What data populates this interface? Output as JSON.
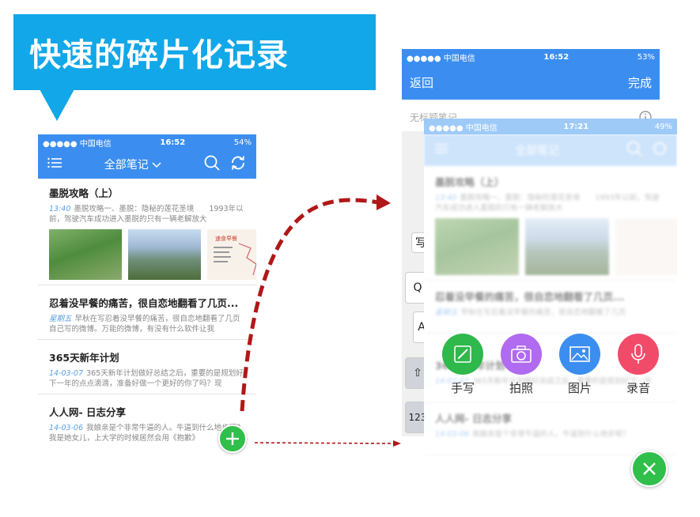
{
  "banner": {
    "title": "快速的碎片化记录"
  },
  "phone1": {
    "status": {
      "carrier": "●●●●● 中国电信",
      "time": "16:52",
      "battery": "54%"
    },
    "nav": {
      "title": "全部笔记"
    },
    "notes": [
      {
        "title": "墨脱攻略（上）",
        "date": "13:40",
        "body": "墨脱攻略一、墨脱：隐秘的莲花圣境　　1993年以前，驾驶汽车成功进入墨脱的只有一辆老解放大"
      },
      {
        "title": "忍着没早餐的痛苦，很自恋地翻看了几页...",
        "date": "星期五",
        "body": "早秋在写忍着没早餐的痛苦，很自恋地翻看了几页自己写的微博。万能的微博，有没有什么软件让我"
      },
      {
        "title": "365天新年计划",
        "date": "14-03-07",
        "body": "365天新年计划做好总结之后，重要的是规划好下一年的点点滴滴，准备好做一个更好的你了吗？现"
      },
      {
        "title": "人人网- 日志分享",
        "date": "14-03-06",
        "body": "我娘亲是个非常牛逼的人。牛逼到什么地步呢？我是她女儿，上大学的时候居然会用《抱歉》"
      }
    ],
    "thumb3_text": "速食早餐"
  },
  "phone2": {
    "status": {
      "carrier": "●●●●● 中国电信",
      "time": "16:52",
      "battery": "53%"
    },
    "nav": {
      "back": "返回",
      "done": "完成"
    },
    "untitled": "无标题笔记",
    "keys": [
      "Q",
      "A",
      "⇧",
      "123",
      "写"
    ]
  },
  "phone3": {
    "status": {
      "carrier": "●●●●● 中国电信",
      "time": "17:21",
      "battery": "49%"
    },
    "nav": {
      "title": "全部笔记"
    },
    "notes": [
      {
        "title": "墨脱攻略（上）",
        "date": "13:40",
        "body": "墨脱攻略一、墨脱：隐秘的莲花圣境　　1993年以前，驾驶汽车成功进入墨脱的只有一辆老解放大"
      },
      {
        "title": "忍着没早餐的痛苦，很自恋地翻看了几页...",
        "date": "星期五",
        "body": "早秋在写忍着没早餐的痛苦，很自恋地翻看了几页"
      },
      {
        "title": "365天新年计划",
        "date": "14-03-07",
        "body": "365天新年计划做好总结之后，重要的是规划好下一年"
      },
      {
        "title": "人人网- 日志分享",
        "date": "14-03-06",
        "body": "我娘亲是个非常牛逼的人。牛逼到什么地步呢？"
      }
    ],
    "actions": [
      {
        "label": "手写",
        "color": "#2fb84b",
        "icon": "pencil-icon"
      },
      {
        "label": "拍照",
        "color": "#b06bf0",
        "icon": "camera-icon"
      },
      {
        "label": "图片",
        "color": "#3b8ef0",
        "icon": "image-icon"
      },
      {
        "label": "录音",
        "color": "#f24b6a",
        "icon": "microphone-icon"
      }
    ]
  },
  "colors": {
    "banner": "#12a7e8",
    "nav": "#3b8ef0",
    "fab": "#2fbf4a",
    "arrow": "#b01818"
  }
}
